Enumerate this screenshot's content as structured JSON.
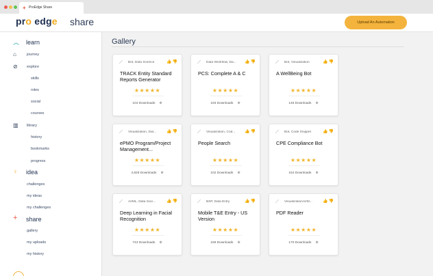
{
  "browser": {
    "tab_title": "ProEdge Share",
    "dots": [
      "#ee5a52",
      "#f5be4f",
      "#5fc454"
    ]
  },
  "header": {
    "logo_part1": "pr",
    "logo_o": "o",
    "logo_part2": " edg",
    "logo_end": "e",
    "section_title": "share",
    "upload_button": "Upload An Automation"
  },
  "sidebar": {
    "learn": {
      "label": "learn",
      "journey": "journey",
      "explore": "explore",
      "skills": "skills",
      "roles": "roles",
      "social": "social",
      "courses": "courses",
      "library": "library",
      "history": "history",
      "bookmarks": "bookmarks",
      "progress": "progress"
    },
    "idea": {
      "label": "idea",
      "challenges": "challenges",
      "my_ideas": "my ideas",
      "my_challenges": "my challenges"
    },
    "share": {
      "label": "share",
      "gallery": "gallery",
      "my_uploads": "my uploads",
      "my_history": "my history"
    }
  },
  "main": {
    "title": "Gallery",
    "stars": "★★★★★",
    "thumbs": "👍👎",
    "cards": [
      {
        "tags": "Bot, Data Science",
        "name": "TRACK Entity Standard Reports Generator",
        "downloads": "104 Downloads"
      },
      {
        "tags": "Data Workflow, Da...",
        "name": "PCS: Complete A & C",
        "downloads": "193 Downloads"
      },
      {
        "tags": "Bot, Visualization",
        "name": "A WellBeing Bot",
        "downloads": "146 Downloads"
      },
      {
        "tags": "Visualization, Dat...",
        "name": "ePMO Program/Project Management...",
        "downloads": "4,828 Downloads"
      },
      {
        "tags": "Visualization, Cod...",
        "name": "People Search",
        "downloads": "102 Downloads"
      },
      {
        "tags": "Bot, Code Snippet",
        "name": "CPE Compliance Bot",
        "downloads": "154 Downloads"
      },
      {
        "tags": "AI/ML, Data Scie...",
        "name": "Deep Learning in Facial Recognition",
        "downloads": "743 Downloads"
      },
      {
        "tags": "BSP, Data Entry",
        "name": "Mobile T&E Entry - US Version",
        "downloads": "159 Downloads"
      },
      {
        "tags": "VisualizationAI/M...",
        "name": "PDF Reader",
        "downloads": "170 Downloads"
      }
    ]
  }
}
